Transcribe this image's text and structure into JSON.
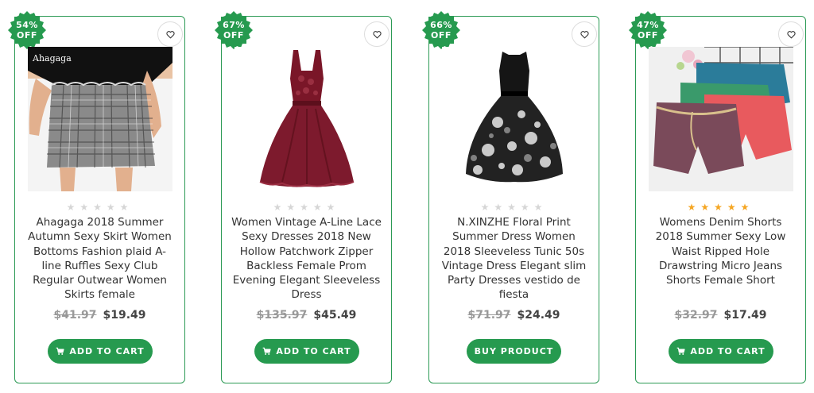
{
  "products": [
    {
      "discount": "54%",
      "off": "OFF",
      "stars": "★★★★★",
      "rated": false,
      "title": "Ahagaga 2018 Summer Autumn Sexy Skirt Women Bottoms Fashion plaid A-line Ruffles Sexy Club Regular Outwear Women Skirts female",
      "old_price": "$41.97",
      "new_price": "$19.49",
      "button": "ADD TO CART",
      "cart_icon": "cart-icon"
    },
    {
      "discount": "67%",
      "off": "OFF",
      "stars": "★★★★★",
      "rated": false,
      "title": "Women Vintage A-Line Lace Sexy Dresses 2018 New Hollow Patchwork Zipper Backless Female Prom Evening Elegant Sleeveless Dress",
      "old_price": "$135.97",
      "new_price": "$45.49",
      "button": "ADD TO CART",
      "cart_icon": "cart-icon"
    },
    {
      "discount": "66%",
      "off": "OFF",
      "stars": "★★★★★",
      "rated": false,
      "title": "N.XINZHE Floral Print Summer Dress Women 2018 Sleeveless Tunic 50s Vintage Dress Elegant slim Party Dresses vestido de fiesta",
      "old_price": "$71.97",
      "new_price": "$24.49",
      "button": "BUY PRODUCT"
    },
    {
      "discount": "47%",
      "off": "OFF",
      "stars": "★★★★★",
      "rated": true,
      "title": "Womens Denim Shorts 2018 Summer Sexy Low Waist Ripped Hole Drawstring Micro Jeans Shorts Female Short",
      "old_price": "$32.97",
      "new_price": "$17.49",
      "button": "ADD TO CART",
      "cart_icon": "cart-icon"
    }
  ],
  "colors": {
    "accent": "#269a4f",
    "border": "#2c9a55",
    "star_gold": "#f5a623",
    "star_empty": "#d6d6d6"
  },
  "images": {
    "p0_watermark": "Ahagaga"
  }
}
